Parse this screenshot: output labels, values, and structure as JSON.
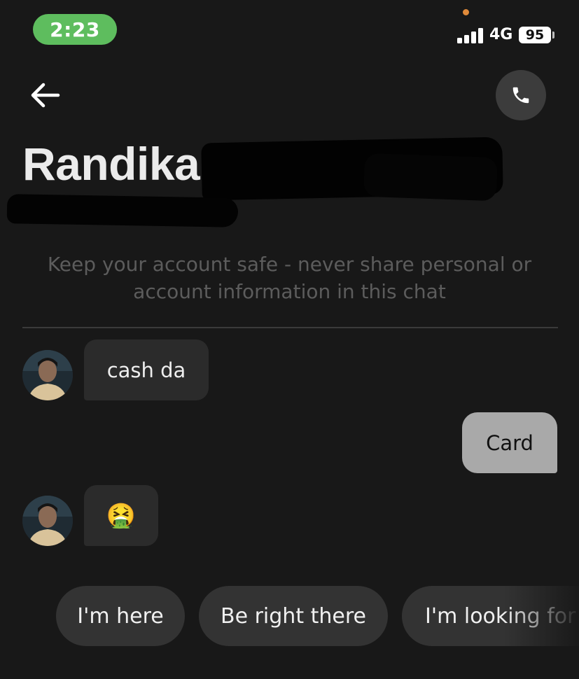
{
  "status_bar": {
    "time": "2:23",
    "network": "4G",
    "battery": "95",
    "icons": [
      "signal-bars-icon",
      "battery-icon"
    ]
  },
  "header": {
    "back_icon": "arrow-left-icon",
    "call_icon": "phone-icon",
    "contact_name": "Randika"
  },
  "safety_notice": "Keep your account safe - never share personal or account information in this chat",
  "messages": [
    {
      "direction": "incoming",
      "text": "cash da"
    },
    {
      "direction": "outgoing",
      "text": "Card"
    },
    {
      "direction": "incoming",
      "text": "🤮"
    }
  ],
  "quick_replies": [
    "I'm here",
    "Be right there",
    "I'm looking for"
  ],
  "colors": {
    "background": "#181818",
    "incoming_bubble": "#2b2b2b",
    "outgoing_bubble": "#a9a9a9",
    "time_pill": "#5ebd5e",
    "chip": "#333333"
  }
}
